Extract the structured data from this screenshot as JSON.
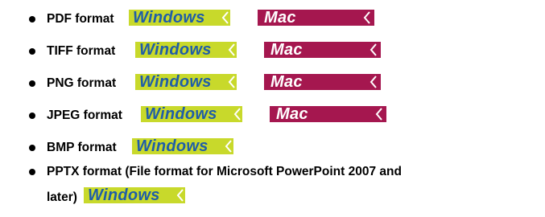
{
  "formats": [
    {
      "label": "PDF format",
      "windows": "Windows",
      "mac": "Mac"
    },
    {
      "label": "TIFF format",
      "windows": "Windows",
      "mac": "Mac"
    },
    {
      "label": "PNG format",
      "windows": "Windows",
      "mac": "Mac"
    },
    {
      "label": "JPEG format",
      "windows": "Windows",
      "mac": "Mac"
    },
    {
      "label": "BMP format",
      "windows": "Windows"
    },
    {
      "label": "PPTX format (File format for Microsoft PowerPoint 2007 and",
      "label_cont": "later)",
      "windows": "Windows"
    }
  ],
  "colors": {
    "windows_bg": "#c8d92b",
    "windows_text": "#1f5da8",
    "mac_bg": "#a5174f",
    "mac_text": "#ffffff"
  },
  "icons": {
    "windows_arrow": "chevron-left-icon",
    "mac_arrow": "chevron-left-icon",
    "bullet": "bullet-icon"
  }
}
